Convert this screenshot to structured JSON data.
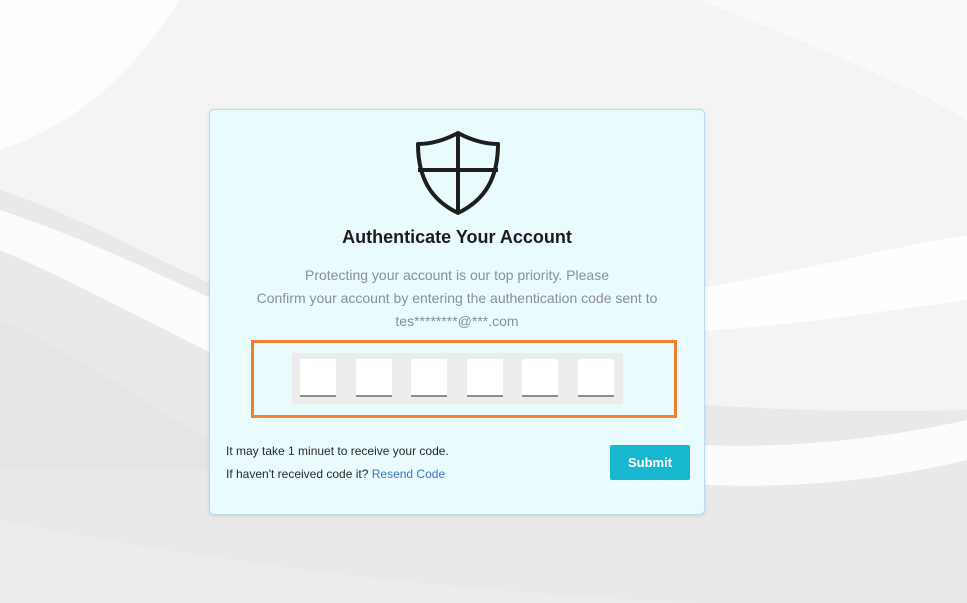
{
  "background": {
    "color": "#f3f3f3"
  },
  "card": {
    "icon": "shield-icon",
    "title": "Authenticate Your Account",
    "description": [
      "Protecting your account is our top priority. Please",
      "Confirm your account by entering the authentication code sent to",
      "tes********@***.com"
    ],
    "code_inputs": [
      "",
      "",
      "",
      "",
      "",
      ""
    ],
    "note_line1": "It may take 1 minuet to receive your code.",
    "note_line2_prefix": "If haven't received code it?",
    "resend_label": "Resend Code",
    "submit_label": "Submit"
  },
  "colors": {
    "card_bg": "#e9fbfd",
    "submit_bg": "#17b8cf",
    "link": "#3a74c4",
    "highlight_border": "#f0822f"
  }
}
